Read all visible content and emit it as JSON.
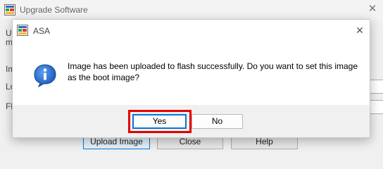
{
  "background_window": {
    "title": "Upgrade Software",
    "partial_labels": [
      "Up",
      "mi",
      "Im",
      "Lo",
      "Fla"
    ],
    "buttons": {
      "upload": "Upload Image",
      "close": "Close",
      "help": "Help"
    }
  },
  "dialog": {
    "title": "ASA",
    "message": "Image has been uploaded to flash successfully. Do you want to set this image as the boot image?",
    "buttons": {
      "yes": "Yes",
      "no": "No"
    },
    "icon": "information-icon"
  },
  "colors": {
    "highlight": "#e30000",
    "info_icon": "#1e66c8",
    "focus_border": "#0078d7"
  }
}
